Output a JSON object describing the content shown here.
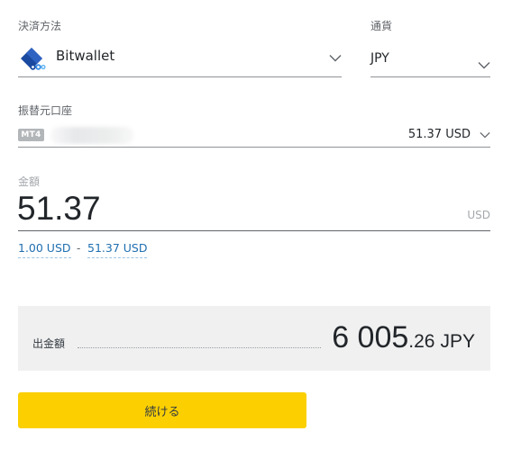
{
  "payment_method": {
    "label": "決済方法",
    "value": "Bitwallet",
    "logo_icon": "bitwallet-logo",
    "brand_color": "#1a4aa0"
  },
  "currency": {
    "label": "通貨",
    "value": "JPY"
  },
  "source_account": {
    "label": "振替元口座",
    "badge": "MT4",
    "balance": "51.37 USD"
  },
  "amount": {
    "label": "金額",
    "value": "51.37",
    "unit": "USD",
    "min": "1.00 USD",
    "separator": "-",
    "max": "51.37 USD"
  },
  "summary": {
    "label": "出金額",
    "amount_integer": "6 005",
    "amount_decimal": ".26",
    "currency": "JPY"
  },
  "continue_button": {
    "label": "続ける",
    "color": "#fbcf00"
  }
}
